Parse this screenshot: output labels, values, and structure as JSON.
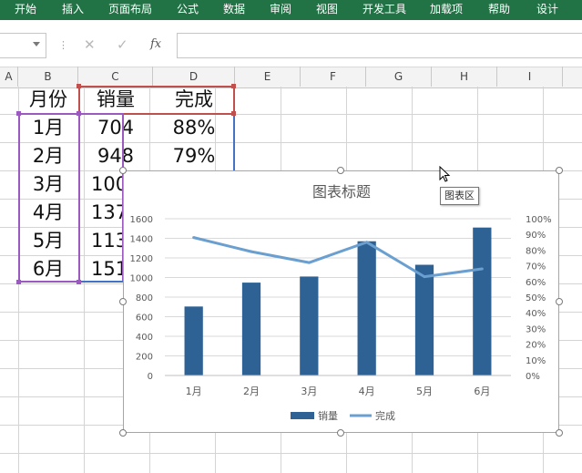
{
  "ribbon": {
    "tabs": [
      "开始",
      "插入",
      "页面布局",
      "公式",
      "数据",
      "审阅",
      "视图",
      "开发工具",
      "加载项",
      "帮助",
      "设计"
    ]
  },
  "formula_bar": {
    "cancel_icon": "✕",
    "enter_icon": "✓",
    "fx_label": "fx"
  },
  "columns": [
    "A",
    "B",
    "C",
    "D",
    "E",
    "F",
    "G",
    "H",
    "I"
  ],
  "sheet": {
    "headers": [
      "月份",
      "销量",
      "完成"
    ],
    "rows": [
      {
        "month": "1月",
        "sales": "704",
        "done": "88%"
      },
      {
        "month": "2月",
        "sales": "948",
        "done": "79%"
      },
      {
        "month": "3月",
        "sales": "100"
      },
      {
        "month": "4月",
        "sales": "137"
      },
      {
        "month": "5月",
        "sales": "113"
      },
      {
        "month": "6月",
        "sales": "151"
      }
    ]
  },
  "tooltip": "图表区",
  "colors": {
    "ribbon": "#217346",
    "bar": "#2e6295",
    "line": "#6a9fd0"
  },
  "chart_data": {
    "type": "bar",
    "title": "图表标题",
    "categories": [
      "1月",
      "2月",
      "3月",
      "4月",
      "5月",
      "6月"
    ],
    "series": [
      {
        "name": "销量",
        "type": "bar",
        "axis": "left",
        "values": [
          704,
          948,
          1010,
          1370,
          1130,
          1510
        ]
      },
      {
        "name": "完成",
        "type": "line",
        "axis": "right",
        "values": [
          0.88,
          0.79,
          0.72,
          0.85,
          0.63,
          0.68
        ]
      }
    ],
    "ylim": [
      0,
      1600
    ],
    "y2lim": [
      0,
      1
    ],
    "yticks": [
      "0",
      "200",
      "400",
      "600",
      "800",
      "1000",
      "1200",
      "1400",
      "1600"
    ],
    "y2ticks": [
      "0%",
      "10%",
      "20%",
      "30%",
      "40%",
      "50%",
      "60%",
      "70%",
      "80%",
      "90%",
      "100%"
    ],
    "legend": "bottom",
    "grid": true
  }
}
